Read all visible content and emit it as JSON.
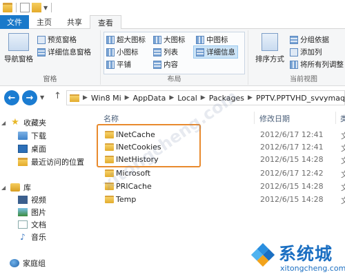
{
  "ribbon": {
    "tabs": [
      "文件",
      "主页",
      "共享",
      "查看"
    ],
    "nav_pane_group": {
      "label": "窗格",
      "nav_pane_button": "导航窗格",
      "preview_pane": "预览窗格",
      "details_pane": "详细信息窗格"
    },
    "layout_group": {
      "label": "布局",
      "items": [
        "超大图标",
        "大图标",
        "中图标",
        "小图标",
        "列表",
        "详细信息",
        "平铺",
        "内容"
      ],
      "selected": "详细信息"
    },
    "current_view_group": {
      "label": "当前视图",
      "sort_by": "排序方式",
      "group_by": "分组依据",
      "add_column": "添加列",
      "fit_columns": "将所有列调整"
    }
  },
  "address": {
    "segments": [
      "Win8 Mi",
      "AppData",
      "Local",
      "Packages",
      "PPTV.PPTVHD_svvymaqd"
    ]
  },
  "nav_pane": {
    "favorites": "收藏夹",
    "favorites_items": [
      "下载",
      "桌面",
      "最近访问的位置"
    ],
    "libraries": "库",
    "library_items": [
      "视频",
      "图片",
      "文档",
      "音乐"
    ],
    "homegroup": "家庭组"
  },
  "columns": {
    "name": "名称",
    "modified": "修改日期",
    "type": "类型"
  },
  "files": [
    {
      "name": "INetCache",
      "modified": "2012/6/17 12:41"
    },
    {
      "name": "INetCookies",
      "modified": "2012/6/17 12:41"
    },
    {
      "name": "INetHistory",
      "modified": "2012/6/15 14:28"
    },
    {
      "name": "Microsoft",
      "modified": "2012/6/17 12:42"
    },
    {
      "name": "PRICache",
      "modified": "2012/6/15 14:28"
    },
    {
      "name": "Temp",
      "modified": "2012/6/15 14:28"
    }
  ],
  "watermark": {
    "logo_cn": "系统城",
    "logo_en": "xitongcheng.com"
  },
  "colors": {
    "accent": "#1979ca",
    "highlight": "#e8892c",
    "folder": "#e3ac2d"
  }
}
